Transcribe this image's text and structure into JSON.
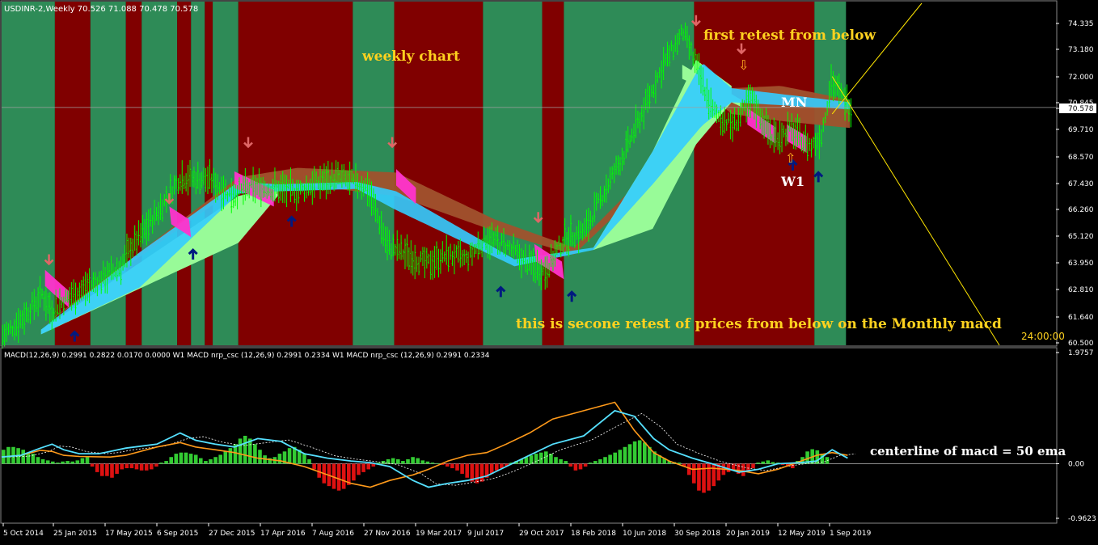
{
  "header": {
    "symbol_line": "USDINR-2,Weekly  70.526 71.088 70.478 70.578"
  },
  "indicator_header": {
    "text": "MACD(12,26,9) 0.2991 0.2822 0.0170 0.0000  W1 MACD nrp_csc (12,26,9) 0.2991 0.2334  W1 MACD nrp_csc (12,26,9) 0.2991 0.2334"
  },
  "annotations": {
    "weekly_chart": "weekly chart",
    "first_retest": "first retest from below",
    "second_retest": "this is secone retest of prices from below on the Monthly macd",
    "mn": "MN",
    "w1": "W1",
    "centerline": "centerline of macd = 50 ema",
    "countdown": "24:00:00"
  },
  "colors": {
    "background": "#000000",
    "green_zone": "#2e8b57",
    "red_zone": "#800000",
    "candle": "#00ff00",
    "macd_hist_pos": "#33cc33",
    "macd_hist_neg": "#dd1111",
    "macd_line_cyan": "#55e0ff",
    "macd_line_orange": "#ff9a1a",
    "signal_dotted": "#ffffff",
    "annotation": "#ffd21f",
    "arrow_down": "#e06666",
    "arrow_up": "#001a80",
    "cloud_monthly": "#a0522d",
    "cloud_weekly_up": "#98fb98",
    "cloud_magenta": "#ff33cc",
    "cloud_cyan": "#33ccff",
    "axis_text": "#ffffff"
  },
  "chart_data": [
    {
      "type": "candlestick",
      "title": "USDINR-2,Weekly",
      "price_axis_ticks": [
        "74.335",
        "73.180",
        "72.000",
        "70.845",
        "70.578",
        "69.710",
        "68.570",
        "67.430",
        "66.260",
        "65.120",
        "63.950",
        "62.810",
        "61.640",
        "60.500"
      ],
      "current_price": "70.578",
      "ylim": [
        60.5,
        74.335
      ],
      "x_axis_ticks": [
        "5 Oct 2014",
        "25 Jan 2015",
        "17 May 2015",
        "6 Sep 2015",
        "27 Dec 2015",
        "17 Apr 2016",
        "7 Aug 2016",
        "27 Nov 2016",
        "19 Mar 2017",
        "9 Jul 2017",
        "29 Oct 2017",
        "18 Feb 2018",
        "10 Jun 2018",
        "30 Sep 2018",
        "20 Jan 2019",
        "12 May 2019",
        "1 Sep 2019"
      ],
      "trend_path": [
        [
          0,
          60.8
        ],
        [
          10,
          61.6
        ],
        [
          20,
          62.6
        ],
        [
          25,
          61.9
        ],
        [
          32,
          62.4
        ],
        [
          45,
          63.0
        ],
        [
          60,
          63.8
        ],
        [
          65,
          64.6
        ],
        [
          70,
          65.1
        ],
        [
          80,
          66.3
        ],
        [
          90,
          67.6
        ],
        [
          105,
          67.5
        ],
        [
          115,
          66.9
        ],
        [
          130,
          67.2
        ],
        [
          150,
          67.0
        ],
        [
          160,
          67.4
        ],
        [
          170,
          67.6
        ],
        [
          185,
          67.2
        ],
        [
          195,
          64.7
        ],
        [
          205,
          64.3
        ],
        [
          215,
          63.9
        ],
        [
          225,
          64.3
        ],
        [
          235,
          64.1
        ],
        [
          245,
          65.0
        ],
        [
          255,
          64.7
        ],
        [
          265,
          64.0
        ],
        [
          275,
          63.6
        ],
        [
          285,
          65.0
        ],
        [
          295,
          65.3
        ],
        [
          305,
          67.0
        ],
        [
          315,
          68.6
        ],
        [
          325,
          70.5
        ],
        [
          335,
          72.4
        ],
        [
          345,
          73.8
        ],
        [
          350,
          72.7
        ],
        [
          360,
          70.4
        ],
        [
          370,
          69.8
        ],
        [
          380,
          70.9
        ],
        [
          390,
          69.3
        ],
        [
          400,
          69.6
        ],
        [
          410,
          68.9
        ],
        [
          415,
          69.4
        ],
        [
          420,
          71.7
        ],
        [
          425,
          71.1
        ],
        [
          430,
          70.6
        ]
      ],
      "zones": [
        {
          "from": 0,
          "to": 27,
          "color": "green_zone"
        },
        {
          "from": 27,
          "to": 45,
          "color": "red_zone"
        },
        {
          "from": 45,
          "to": 63,
          "color": "green_zone"
        },
        {
          "from": 63,
          "to": 71,
          "color": "red_zone"
        },
        {
          "from": 71,
          "to": 89,
          "color": "green_zone"
        },
        {
          "from": 89,
          "to": 96,
          "color": "red_zone"
        },
        {
          "from": 96,
          "to": 103,
          "color": "green_zone"
        },
        {
          "from": 103,
          "to": 107,
          "color": "red_zone"
        },
        {
          "from": 107,
          "to": 120,
          "color": "green_zone"
        },
        {
          "from": 120,
          "to": 178,
          "color": "red_zone"
        },
        {
          "from": 178,
          "to": 199,
          "color": "green_zone"
        },
        {
          "from": 199,
          "to": 244,
          "color": "red_zone"
        },
        {
          "from": 244,
          "to": 274,
          "color": "green_zone"
        },
        {
          "from": 274,
          "to": 285,
          "color": "red_zone"
        },
        {
          "from": 285,
          "to": 351,
          "color": "green_zone"
        },
        {
          "from": 351,
          "to": 412,
          "color": "red_zone"
        },
        {
          "from": 412,
          "to": 428,
          "color": "green_zone"
        }
      ],
      "down_arrows": [
        [
          24,
          63.9
        ],
        [
          85,
          66.5
        ],
        [
          125,
          68.9
        ],
        [
          198,
          68.9
        ],
        [
          272,
          65.7
        ],
        [
          352,
          74.1
        ],
        [
          375,
          72.9
        ]
      ],
      "up_arrows": [
        [
          37,
          61.0
        ],
        [
          97,
          64.5
        ],
        [
          147,
          65.9
        ],
        [
          253,
          62.9
        ],
        [
          289,
          62.7
        ],
        [
          414,
          67.8
        ],
        [
          401,
          68.3
        ]
      ],
      "monthly_cloud_top": [
        [
          20,
          61.2
        ],
        [
          120,
          67.6
        ],
        [
          150,
          68.0
        ],
        [
          200,
          67.8
        ],
        [
          250,
          65.8
        ],
        [
          290,
          64.6
        ],
        [
          330,
          68.0
        ],
        [
          350,
          72.2
        ],
        [
          370,
          71.4
        ],
        [
          395,
          71.5
        ],
        [
          430,
          70.9
        ]
      ],
      "monthly_cloud_bot": [
        [
          20,
          61.2
        ],
        [
          120,
          67.2
        ],
        [
          150,
          67.3
        ],
        [
          200,
          66.8
        ],
        [
          250,
          65.3
        ],
        [
          290,
          64.3
        ],
        [
          330,
          67.5
        ],
        [
          350,
          71.8
        ],
        [
          370,
          70.3
        ],
        [
          395,
          70.0
        ],
        [
          430,
          69.7
        ]
      ],
      "weekly_cloud_top": [
        [
          20,
          61.1
        ],
        [
          70,
          64.4
        ],
        [
          120,
          67.4
        ],
        [
          140,
          67.3
        ],
        [
          180,
          67.4
        ],
        [
          200,
          67.0
        ],
        [
          260,
          64.1
        ],
        [
          300,
          64.6
        ],
        [
          330,
          68.7
        ],
        [
          355,
          72.5
        ],
        [
          370,
          71.4
        ],
        [
          430,
          70.8
        ]
      ],
      "weekly_cloud_bot": [
        [
          20,
          60.9
        ],
        [
          70,
          62.9
        ],
        [
          120,
          66.9
        ],
        [
          140,
          67.0
        ],
        [
          180,
          67.1
        ],
        [
          200,
          66.2
        ],
        [
          260,
          63.8
        ],
        [
          300,
          64.5
        ],
        [
          330,
          67.3
        ],
        [
          355,
          69.8
        ],
        [
          370,
          70.8
        ],
        [
          430,
          70.5
        ]
      ]
    },
    {
      "type": "histogram+line",
      "title": "MACD(12,26,9)",
      "axis_ticks": [
        "1.9757",
        "0.00",
        "-0.9623"
      ],
      "ylim": [
        -0.9623,
        1.9757
      ],
      "histogram": [
        0.25,
        0.3,
        0.3,
        0.28,
        0.25,
        0.2,
        0.18,
        0.12,
        0.08,
        0.06,
        0.04,
        0.02,
        0.04,
        0.05,
        0.04,
        0.06,
        0.1,
        0.12,
        -0.05,
        -0.15,
        -0.22,
        -0.22,
        -0.25,
        -0.18,
        -0.1,
        -0.08,
        -0.08,
        -0.1,
        -0.12,
        -0.12,
        -0.1,
        -0.05,
        0.02,
        0.05,
        0.12,
        0.18,
        0.2,
        0.2,
        0.18,
        0.16,
        0.1,
        0.05,
        0.08,
        0.12,
        0.16,
        0.22,
        0.28,
        0.35,
        0.45,
        0.5,
        0.45,
        0.35,
        0.25,
        0.15,
        0.1,
        0.12,
        0.18,
        0.22,
        0.28,
        0.3,
        0.25,
        0.18,
        0.08,
        -0.1,
        -0.25,
        -0.35,
        -0.4,
        -0.45,
        -0.48,
        -0.45,
        -0.38,
        -0.3,
        -0.2,
        -0.15,
        -0.1,
        -0.05,
        0.02,
        0.05,
        0.08,
        0.1,
        0.08,
        0.05,
        0.08,
        0.12,
        0.1,
        0.06,
        0.04,
        0.02,
        0.01,
        -0.02,
        -0.05,
        -0.08,
        -0.12,
        -0.18,
        -0.25,
        -0.32,
        -0.35,
        -0.32,
        -0.25,
        -0.18,
        -0.12,
        -0.08,
        -0.04,
        0.02,
        0.05,
        0.08,
        0.12,
        0.15,
        0.18,
        0.2,
        0.22,
        0.18,
        0.12,
        0.08,
        0.05,
        -0.05,
        -0.12,
        -0.1,
        -0.05,
        0.02,
        0.05,
        0.08,
        0.12,
        0.16,
        0.2,
        0.25,
        0.3,
        0.35,
        0.4,
        0.42,
        0.38,
        0.3,
        0.22,
        0.15,
        0.1,
        0.05,
        0.03,
        0.02,
        -0.05,
        -0.2,
        -0.35,
        -0.48,
        -0.52,
        -0.48,
        -0.4,
        -0.3,
        -0.2,
        -0.15,
        -0.12,
        -0.18,
        -0.22,
        -0.15,
        -0.08,
        0.02,
        0.04,
        0.06,
        0.03,
        0.02,
        -0.02,
        -0.05,
        -0.08,
        0.05,
        0.12,
        0.22,
        0.26,
        0.24,
        0.18,
        0.12
      ],
      "macd_line": [
        [
          0,
          0.12
        ],
        [
          5,
          0.15
        ],
        [
          10,
          0.28
        ],
        [
          13,
          0.35
        ],
        [
          16,
          0.25
        ],
        [
          20,
          0.18
        ],
        [
          25,
          0.18
        ],
        [
          28,
          0.22
        ],
        [
          32,
          0.28
        ],
        [
          40,
          0.35
        ],
        [
          46,
          0.55
        ],
        [
          50,
          0.42
        ],
        [
          55,
          0.35
        ],
        [
          60,
          0.3
        ],
        [
          66,
          0.45
        ],
        [
          72,
          0.4
        ],
        [
          78,
          0.18
        ],
        [
          84,
          0.1
        ],
        [
          90,
          0.05
        ],
        [
          95,
          0.02
        ],
        [
          100,
          -0.05
        ],
        [
          106,
          -0.3
        ],
        [
          110,
          -0.42
        ],
        [
          115,
          -0.35
        ],
        [
          120,
          -0.3
        ],
        [
          125,
          -0.22
        ],
        [
          130,
          -0.05
        ],
        [
          136,
          0.15
        ],
        [
          142,
          0.35
        ],
        [
          150,
          0.5
        ],
        [
          158,
          0.95
        ],
        [
          163,
          0.85
        ],
        [
          168,
          0.45
        ],
        [
          172,
          0.25
        ],
        [
          178,
          0.1
        ],
        [
          183,
          0.0
        ],
        [
          190,
          -0.15
        ],
        [
          195,
          -0.1
        ],
        [
          200,
          0.0
        ],
        [
          206,
          0.02
        ],
        [
          210,
          0.05
        ],
        [
          214,
          0.25
        ],
        [
          218,
          0.1
        ]
      ],
      "orange_line": [
        [
          0,
          0.12
        ],
        [
          5,
          0.15
        ],
        [
          10,
          0.24
        ],
        [
          13,
          0.22
        ],
        [
          16,
          0.15
        ],
        [
          20,
          0.13
        ],
        [
          28,
          0.12
        ],
        [
          32,
          0.15
        ],
        [
          40,
          0.3
        ],
        [
          46,
          0.38
        ],
        [
          50,
          0.3
        ],
        [
          55,
          0.25
        ],
        [
          60,
          0.2
        ],
        [
          66,
          0.1
        ],
        [
          72,
          0.05
        ],
        [
          78,
          -0.05
        ],
        [
          84,
          -0.2
        ],
        [
          90,
          -0.35
        ],
        [
          95,
          -0.42
        ],
        [
          100,
          -0.3
        ],
        [
          106,
          -0.2
        ],
        [
          110,
          -0.1
        ],
        [
          115,
          0.05
        ],
        [
          120,
          0.15
        ],
        [
          125,
          0.2
        ],
        [
          130,
          0.35
        ],
        [
          136,
          0.55
        ],
        [
          142,
          0.8
        ],
        [
          150,
          0.95
        ],
        [
          158,
          1.1
        ],
        [
          163,
          0.6
        ],
        [
          168,
          0.2
        ],
        [
          172,
          0.05
        ],
        [
          178,
          -0.1
        ],
        [
          183,
          -0.08
        ],
        [
          190,
          -0.12
        ],
        [
          195,
          -0.18
        ],
        [
          200,
          -0.1
        ],
        [
          206,
          0.05
        ],
        [
          210,
          0.15
        ],
        [
          214,
          0.2
        ],
        [
          218,
          0.15
        ]
      ]
    }
  ]
}
